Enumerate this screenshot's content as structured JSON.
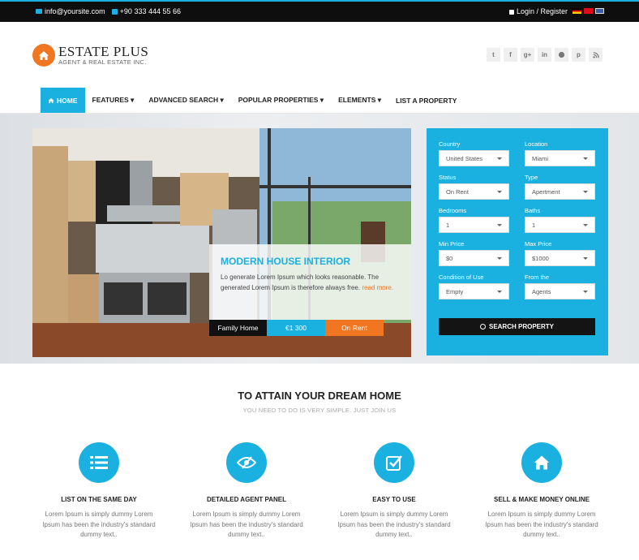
{
  "topbar": {
    "email": "info@yoursite.com",
    "phone": "+90 333 444 55 66",
    "login": "Login / Register"
  },
  "header": {
    "brand": "ESTATE PLUS",
    "tagline": "AGENT & REAL ESTATE INC."
  },
  "social": [
    "twitter-icon",
    "facebook-icon",
    "google-plus-icon",
    "linkedin-icon",
    "github-icon",
    "pinterest-icon",
    "rss-icon"
  ],
  "nav": {
    "home": "HOME",
    "features": "FEATURES ▾",
    "advanced_search": "ADVANCED SEARCH ▾",
    "popular": "POPULAR PROPERTIES ▾",
    "elements": "ELEMENTS ▾",
    "list": "LIST A PROPERTY"
  },
  "hero": {
    "title": "MODERN HOUSE INTERIOR",
    "text": "Lo generate Lorem Ipsum which looks reasonable. The generated Lorem Ipsum is therefore always free.",
    "read_more": "read more.",
    "tag_type": "Family Home",
    "tag_price": "€1 300",
    "tag_status": "On Rent"
  },
  "search": {
    "country_label": "Country",
    "country_value": "United States",
    "location_label": "Location",
    "location_value": "Miami",
    "status_label": "Status",
    "status_value": "On Rent",
    "type_label": "Type",
    "type_value": "Apertment",
    "bedrooms_label": "Bedrooms",
    "bedrooms_value": "1",
    "baths_label": "Baths",
    "baths_value": "1",
    "min_label": "Min Price",
    "min_value": "$0",
    "max_label": "Max Price",
    "max_value": "$1000",
    "condition_label": "Condition of Use",
    "condition_value": "Empty",
    "from_label": "From the",
    "from_value": "Agents",
    "button": "SEARCH PROPERTY"
  },
  "section": {
    "title": "TO ATTAIN YOUR DREAM HOME",
    "subtitle": "YOU NEED TO DO IS VERY SIMPLE. JUST JOIN US"
  },
  "features": [
    {
      "icon": "list-icon",
      "title": "LIST ON THE SAME DAY",
      "text": "Lorem Ipsum is simply dummy Lorem Ipsum has been the industry's standard dummy text.."
    },
    {
      "icon": "eye-icon",
      "title": "DETAILED AGENT PANEL",
      "text": "Lorem Ipsum is simply dummy Lorem Ipsum has been the industry's standard dummy text.."
    },
    {
      "icon": "checkbox-icon",
      "title": "EASY TO USE",
      "text": "Lorem Ipsum is simply dummy Lorem Ipsum has been the industry's standard dummy text.."
    },
    {
      "icon": "home-icon",
      "title": "SELL & MAKE MONEY ONLINE",
      "text": "Lorem Ipsum is simply dummy Lorem Ipsum has been the industry's standard dummy text.."
    }
  ],
  "colors": {
    "accent": "#1ab0e0",
    "orange": "#f07622",
    "dark": "#111111"
  }
}
